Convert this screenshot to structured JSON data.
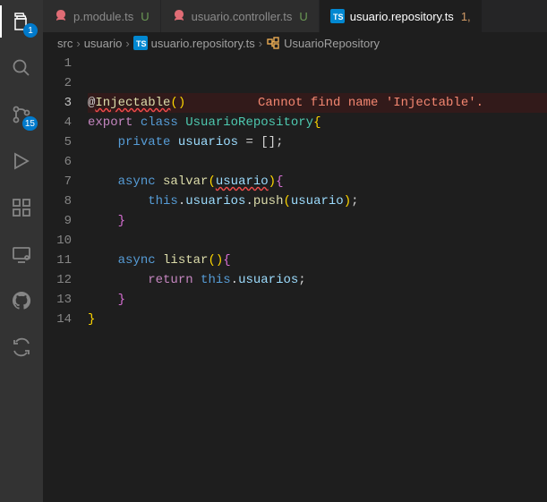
{
  "activity": {
    "explorer_badge": "1",
    "scm_badge": "15"
  },
  "tabs": [
    {
      "label": "p.module.ts",
      "mod": "U",
      "active": false,
      "icon": "nest"
    },
    {
      "label": "usuario.controller.ts",
      "mod": "U",
      "active": false,
      "icon": "nest"
    },
    {
      "label": "usuario.repository.ts",
      "mod": "1,",
      "active": true,
      "icon": "ts"
    }
  ],
  "crumbs": {
    "p0": "src",
    "p1": "usuario",
    "p2": "usuario.repository.ts",
    "p3": "UsuarioRepository"
  },
  "editor": {
    "lines": [
      "1",
      "2",
      "3",
      "4",
      "5",
      "6",
      "7",
      "8",
      "9",
      "10",
      "11",
      "12",
      "13",
      "14"
    ],
    "error_inline": "Cannot find name 'Injectable'.",
    "tok": {
      "at": "@",
      "injectable": "Injectable",
      "export": "export",
      "classkw": "class",
      "clsname": "UsuarioRepository",
      "private": "private",
      "usuarios": "usuarios",
      "eq": "=",
      "empty": "[]",
      "async": "async",
      "salvar": "salvar",
      "usuario_param": "usuario",
      "this": "this",
      "push": "push",
      "listar": "listar",
      "return": "return"
    }
  }
}
